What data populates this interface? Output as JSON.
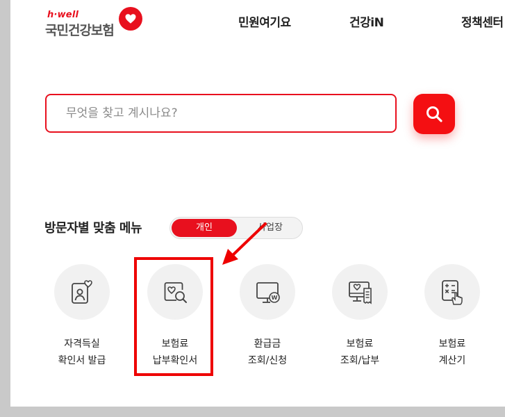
{
  "brand": {
    "logo_small": "h·well",
    "logo_main": "국민건강보험",
    "accent": "#e8101e"
  },
  "nav": {
    "items": [
      "민원여기요",
      "건강iN",
      "정책센터"
    ]
  },
  "search": {
    "placeholder": "무엇을 찾고 계시나요?",
    "value": "",
    "button_icon": "search-icon"
  },
  "menu": {
    "title": "방문자별 맞춤 메뉴",
    "toggle": {
      "selected": "개인",
      "other": "사업장"
    },
    "tiles": [
      {
        "icon": "id-card-heart-icon",
        "line1": "자격득실",
        "line2": "확인서 발급"
      },
      {
        "icon": "document-search-icon",
        "line1": "보험료",
        "line2": "납부확인서"
      },
      {
        "icon": "monitor-won-icon",
        "line1": "환급금",
        "line2": "조회/신청"
      },
      {
        "icon": "monitor-receipt-icon",
        "line1": "보험료",
        "line2": "조회/납부"
      },
      {
        "icon": "calculator-hand-icon",
        "line1": "보험료",
        "line2": "계산기"
      }
    ]
  }
}
